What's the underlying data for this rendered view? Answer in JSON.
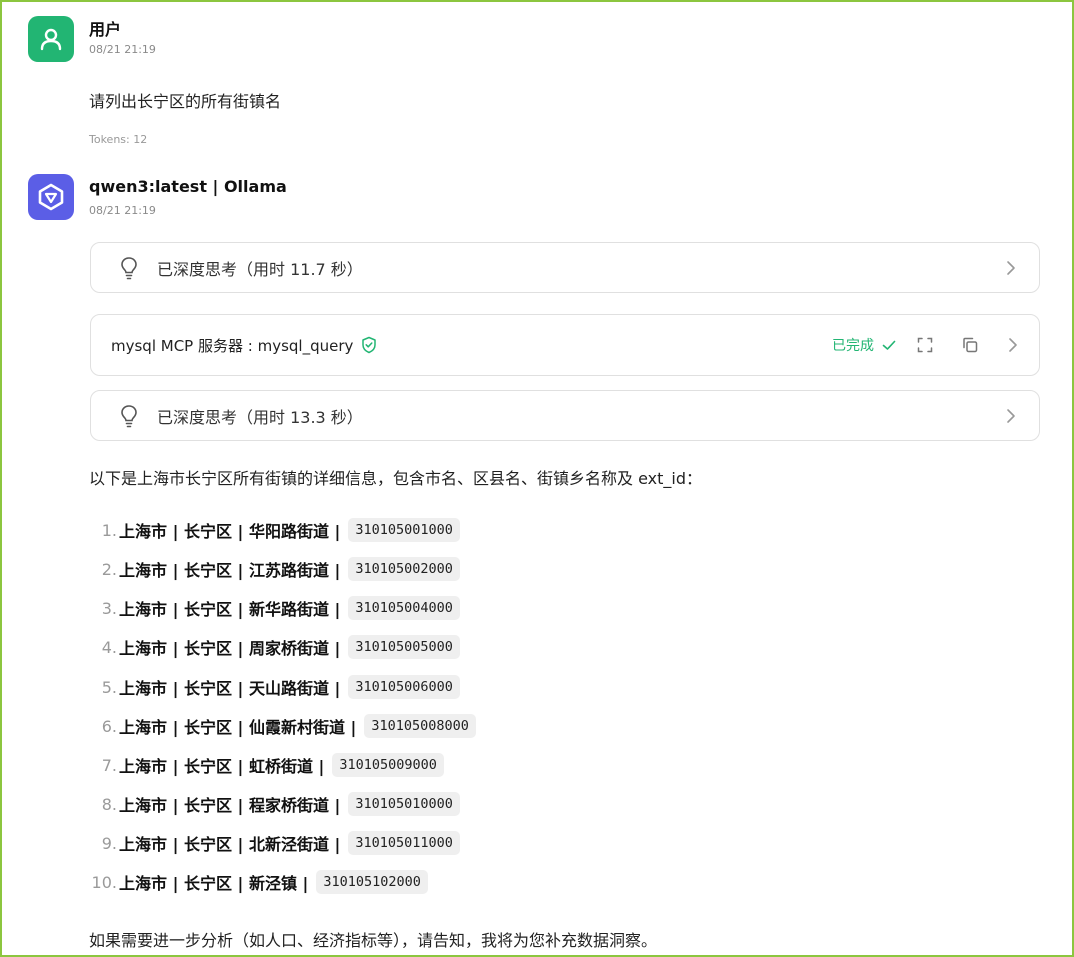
{
  "user_message": {
    "sender": "用户",
    "time": "08/21 21:19",
    "text": "请列出长宁区的所有街镇名",
    "tokens": "Tokens: 12"
  },
  "assistant_message": {
    "sender": "qwen3:latest | Ollama",
    "time": "08/21 21:19",
    "think1": "已深度思考（用时 11.7 秒）",
    "tool": {
      "name": "mysql MCP 服务器 : mysql_query",
      "status": "已完成"
    },
    "think2": "已深度思考（用时 13.3 秒）",
    "intro": "以下是上海市长宁区所有街镇的详细信息，包含市名、区县名、街镇乡名称及 ext_id：",
    "items": [
      {
        "num": "1.",
        "text": "上海市 | 长宁区 | 华阳路街道 |",
        "code": "310105001000"
      },
      {
        "num": "2.",
        "text": "上海市 | 长宁区 | 江苏路街道 |",
        "code": "310105002000"
      },
      {
        "num": "3.",
        "text": "上海市 | 长宁区 | 新华路街道 |",
        "code": "310105004000"
      },
      {
        "num": "4.",
        "text": "上海市 | 长宁区 | 周家桥街道 |",
        "code": "310105005000"
      },
      {
        "num": "5.",
        "text": "上海市 | 长宁区 | 天山路街道 |",
        "code": "310105006000"
      },
      {
        "num": "6.",
        "text": "上海市 | 长宁区 | 仙霞新村街道 |",
        "code": "310105008000"
      },
      {
        "num": "7.",
        "text": "上海市 | 长宁区 | 虹桥街道 |",
        "code": "310105009000"
      },
      {
        "num": "8.",
        "text": "上海市 | 长宁区 | 程家桥街道 |",
        "code": "310105010000"
      },
      {
        "num": "9.",
        "text": "上海市 | 长宁区 | 北新泾街道 |",
        "code": "310105011000"
      },
      {
        "num": "10.",
        "text": "上海市 | 长宁区 | 新泾镇 |",
        "code": "310105102000"
      }
    ],
    "outro": "如果需要进一步分析（如人口、经济指标等），请告知，我将为您补充数据洞察。"
  },
  "colors": {
    "frame": "#8cc63f",
    "user_avatar": "#22b573",
    "bot_avatar": "#5b5ee6",
    "success": "#22b573"
  },
  "icons": [
    "user-icon",
    "qwen-logo-icon",
    "lightbulb-icon",
    "shield-check-icon",
    "check-icon",
    "expand-icon",
    "copy-icon",
    "chevron-right-icon"
  ]
}
